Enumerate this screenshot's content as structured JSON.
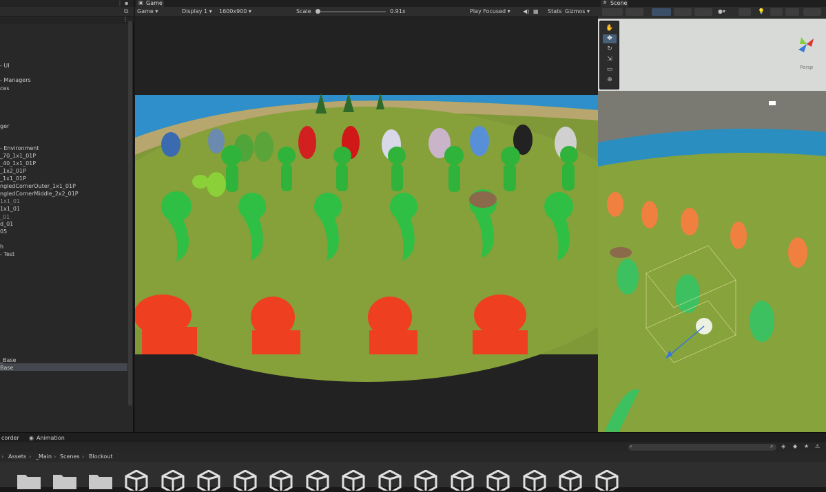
{
  "hierarchy": {
    "items": [
      {
        "label": "- UI",
        "dim": false
      },
      {
        "label": "- Managers",
        "dim": false
      },
      {
        "label": "ces",
        "dim": false
      },
      {
        "label": "ger",
        "dim": false
      },
      {
        "label": "- Environment",
        "dim": false
      },
      {
        "label": "_70_1x1_01P",
        "dim": false
      },
      {
        "label": "_40_1x1_01P",
        "dim": false
      },
      {
        "label": "_1x2_01P",
        "dim": false
      },
      {
        "label": "_1x1_01P",
        "dim": false
      },
      {
        "label": "ngledCornerOuter_1x1_01P",
        "dim": false
      },
      {
        "label": "ngledCornerMiddle_2x2_01P",
        "dim": false
      },
      {
        "label": "1x1_01",
        "dim": true
      },
      {
        "label": "1x1_01",
        "dim": false
      },
      {
        "label": "_01",
        "dim": true
      },
      {
        "label": "d_01",
        "dim": false
      },
      {
        "label": "05",
        "dim": false
      },
      {
        "label": "h",
        "dim": false
      },
      {
        "label": "- Test",
        "dim": false
      },
      {
        "label": "_Base",
        "dim": false
      },
      {
        "label": "Base",
        "dim": false
      }
    ]
  },
  "game": {
    "tab_label": "Game",
    "mode": "Game",
    "display": "Display 1",
    "resolution": "1600x900",
    "scale_label": "Scale",
    "scale_value": "0.91x",
    "play_focused": "Play Focused",
    "stats": "Stats",
    "gizmos": "Gizmos"
  },
  "scene": {
    "tab_label": "Scene",
    "gizmo_label": "Persp"
  },
  "bottom": {
    "tab_recorder": "corder",
    "tab_animation": "Animation"
  },
  "breadcrumb": [
    "Assets",
    "_Main",
    "Scenes",
    "Blockout"
  ],
  "assets": {
    "folder_count": 3,
    "scene_count": 14
  },
  "colors": {
    "selection": "#44484e",
    "active_tool": "#46607a",
    "ground": "#86a03a",
    "water": "#2f8fc8"
  }
}
